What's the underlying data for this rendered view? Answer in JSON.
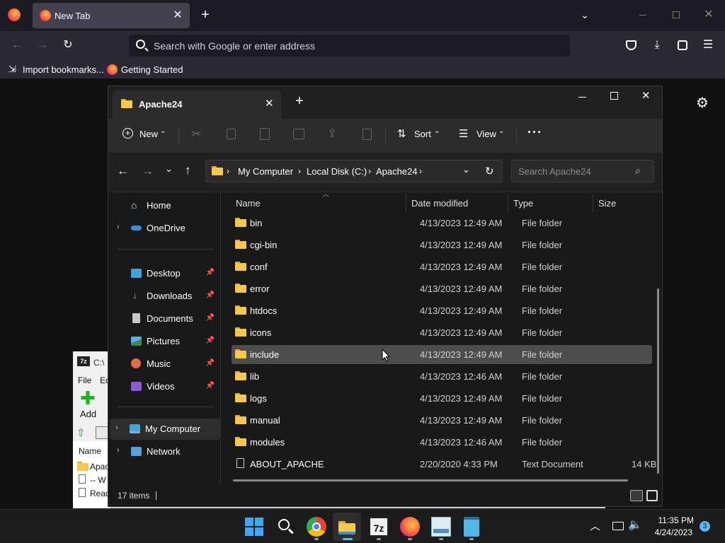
{
  "firefox": {
    "tab_title": "New Tab",
    "url_placeholder": "Search with Google or enter address",
    "bookmarks": [
      "Import bookmarks...",
      "Getting Started"
    ]
  },
  "explorer": {
    "tab_title": "Apache24",
    "toolbar": {
      "new_label": "New",
      "sort_label": "Sort",
      "view_label": "View",
      "more_label": "···"
    },
    "breadcrumb": [
      "My Computer",
      "Local Disk (C:)",
      "Apache24"
    ],
    "search_placeholder": "Search Apache24",
    "nav": {
      "home": "Home",
      "onedrive": "OneDrive",
      "pinned": [
        "Desktop",
        "Downloads",
        "Documents",
        "Pictures",
        "Music",
        "Videos"
      ],
      "my_computer": "My Computer",
      "network": "Network"
    },
    "columns": {
      "name": "Name",
      "date": "Date modified",
      "type": "Type",
      "size": "Size"
    },
    "files": [
      {
        "name": "bin",
        "date": "4/13/2023 12:49 AM",
        "type": "File folder",
        "size": ""
      },
      {
        "name": "cgi-bin",
        "date": "4/13/2023 12:49 AM",
        "type": "File folder",
        "size": ""
      },
      {
        "name": "conf",
        "date": "4/13/2023 12:49 AM",
        "type": "File folder",
        "size": ""
      },
      {
        "name": "error",
        "date": "4/13/2023 12:49 AM",
        "type": "File folder",
        "size": ""
      },
      {
        "name": "htdocs",
        "date": "4/13/2023 12:49 AM",
        "type": "File folder",
        "size": ""
      },
      {
        "name": "icons",
        "date": "4/13/2023 12:49 AM",
        "type": "File folder",
        "size": ""
      },
      {
        "name": "include",
        "date": "4/13/2023 12:49 AM",
        "type": "File folder",
        "size": ""
      },
      {
        "name": "lib",
        "date": "4/13/2023 12:46 AM",
        "type": "File folder",
        "size": ""
      },
      {
        "name": "logs",
        "date": "4/13/2023 12:49 AM",
        "type": "File folder",
        "size": ""
      },
      {
        "name": "manual",
        "date": "4/13/2023 12:49 AM",
        "type": "File folder",
        "size": ""
      },
      {
        "name": "modules",
        "date": "4/13/2023 12:46 AM",
        "type": "File folder",
        "size": ""
      },
      {
        "name": "ABOUT_APACHE",
        "date": "2/20/2020 4:33 PM",
        "type": "Text Document",
        "size": "14 KB"
      }
    ],
    "status": "17 items"
  },
  "sevenzip": {
    "title": "C:\\",
    "menu": [
      "File",
      "Ed"
    ],
    "add_label": "Add",
    "col_name": "Name",
    "items": [
      "Apac",
      "-- W",
      "Read"
    ]
  },
  "taskbar": {
    "time": "11:35 PM",
    "date": "4/24/2023",
    "notification_count": "3"
  }
}
